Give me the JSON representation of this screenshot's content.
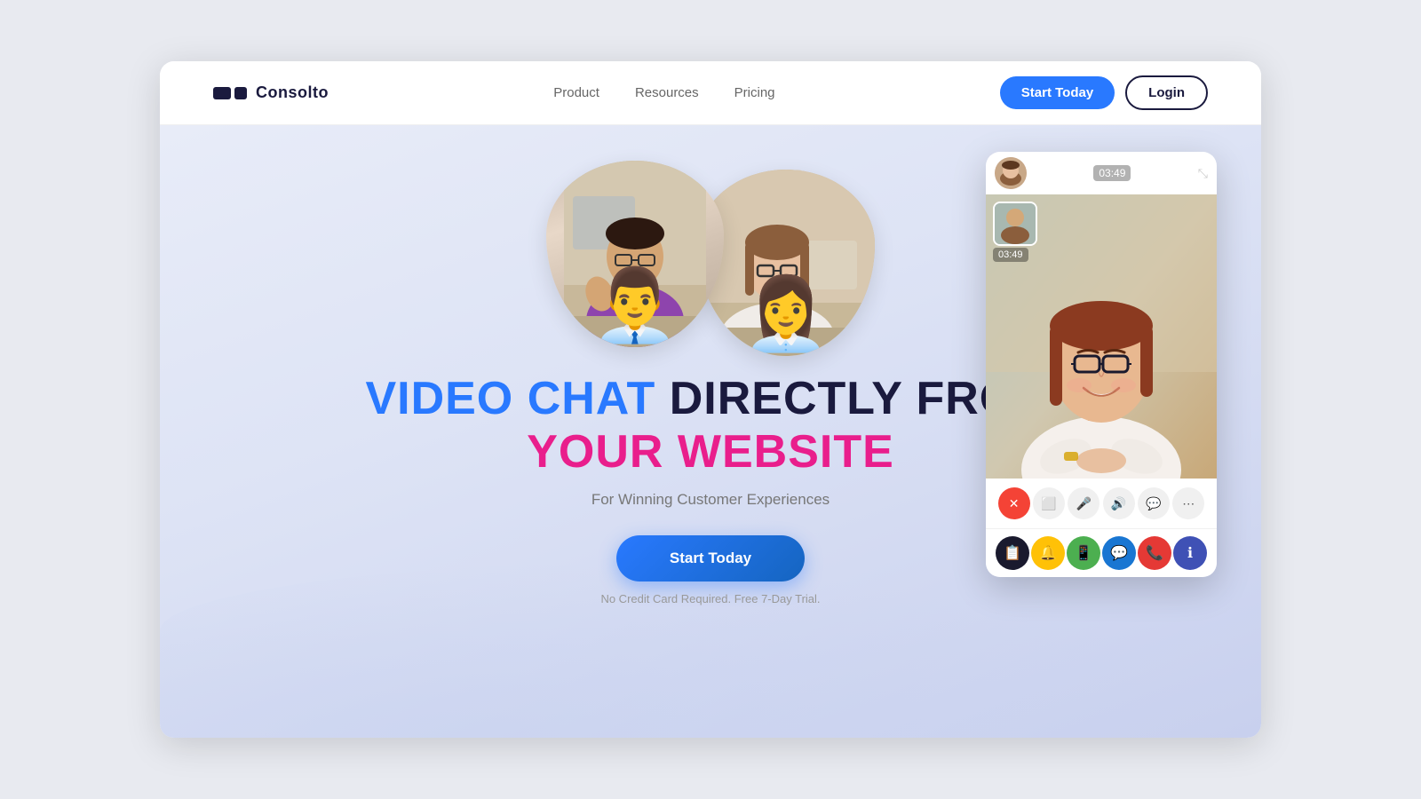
{
  "brand": {
    "name": "Consolto"
  },
  "navbar": {
    "links": [
      {
        "id": "product",
        "label": "Product"
      },
      {
        "id": "resources",
        "label": "Resources"
      },
      {
        "id": "pricing",
        "label": "Pricing"
      }
    ],
    "start_today": "Start Today",
    "login": "Login"
  },
  "hero": {
    "headline_line1_part1": "VIDEO CHAT",
    "headline_line1_part2": "DIRECTLY FROM",
    "headline_line2": "YOUR WEBSITE",
    "subtitle": "For Winning Customer Experiences",
    "cta_button": "Start Today",
    "no_credit_card": "No Credit Card Required. Free 7-Day Trial."
  },
  "video_widget": {
    "timer": "03:49",
    "expand_icon": "⤡",
    "controls": [
      {
        "id": "end-call",
        "icon": "✕",
        "type": "red"
      },
      {
        "id": "screen-share",
        "icon": "⬜",
        "type": "gray"
      },
      {
        "id": "microphone",
        "icon": "🎤",
        "type": "gray"
      },
      {
        "id": "volume",
        "icon": "🔊",
        "type": "gray"
      },
      {
        "id": "chat",
        "icon": "💬",
        "type": "gray"
      },
      {
        "id": "more",
        "icon": "⋯",
        "type": "gray"
      }
    ],
    "social_buttons": [
      {
        "id": "copy",
        "icon": "📋",
        "color": "dark"
      },
      {
        "id": "notify",
        "icon": "🔔",
        "color": "yellow"
      },
      {
        "id": "whatsapp",
        "icon": "📱",
        "color": "green"
      },
      {
        "id": "messenger",
        "icon": "💬",
        "color": "blue"
      },
      {
        "id": "phone",
        "icon": "📞",
        "color": "red"
      },
      {
        "id": "info",
        "icon": "ℹ",
        "color": "indigo"
      }
    ]
  }
}
